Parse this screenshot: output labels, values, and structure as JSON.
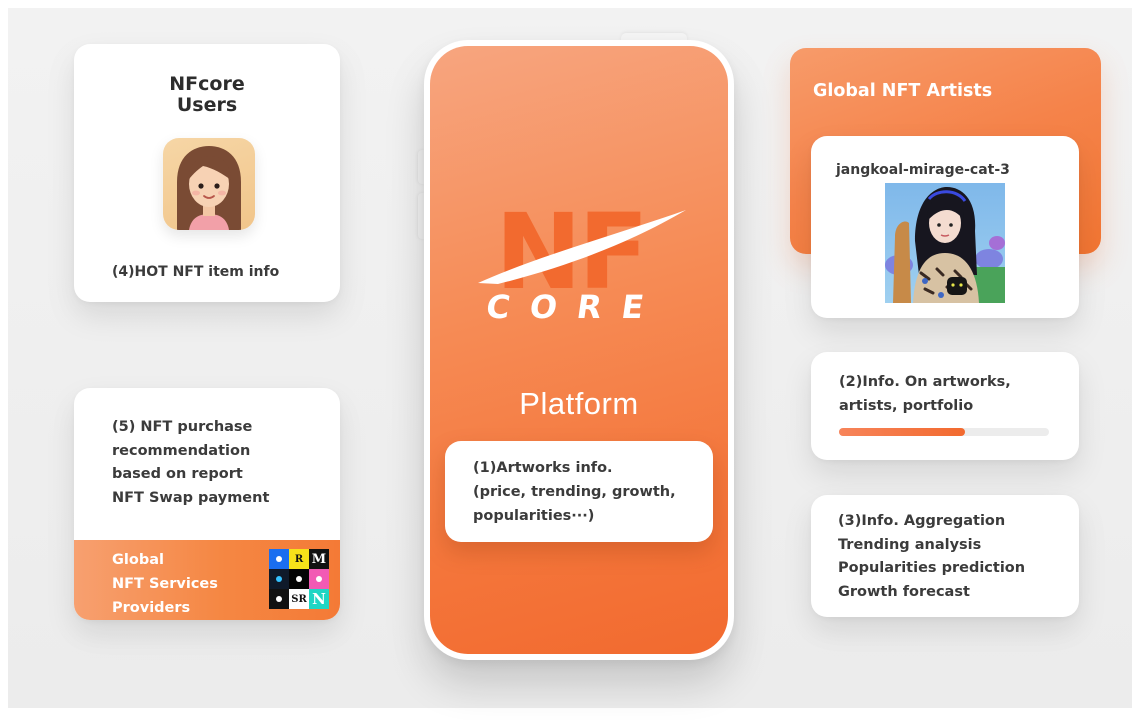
{
  "users_card": {
    "title_line1": "NFcore",
    "title_line2": "Users",
    "hot_label": "(4)HOT NFT item info"
  },
  "purchase_card": {
    "lines": [
      "(5) NFT purchase",
      "recommendation",
      "based on report",
      "NFT Swap payment"
    ],
    "providers_lines": [
      "Global",
      "NFT Services",
      "Providers"
    ],
    "provider_logos": [
      {
        "label": "",
        "bg": "#1a6ef0",
        "fg": "#ffffff"
      },
      {
        "label": "R",
        "bg": "#f7e11a",
        "fg": "#111111"
      },
      {
        "label": "M",
        "bg": "#111111",
        "fg": "#ffffff"
      },
      {
        "label": "",
        "bg": "#0f1a2a",
        "fg": "#35c2ff"
      },
      {
        "label": "",
        "bg": "#050505",
        "fg": "#ffffff"
      },
      {
        "label": "",
        "bg": "#f25ab4",
        "fg": "#ffffff"
      },
      {
        "label": "",
        "bg": "#111111",
        "fg": "#ffffff"
      },
      {
        "label": "SR",
        "bg": "#ffffff",
        "fg": "#111111"
      },
      {
        "label": "N",
        "bg": "#1fd6c4",
        "fg": "#ffffff"
      }
    ]
  },
  "phone": {
    "logo_top": "NF",
    "logo_bottom": "CORE",
    "platform_label": "Platform",
    "artworks_lines": [
      "(1)Artworks info.",
      "(price, trending, growth,",
      "popularities···)"
    ]
  },
  "artists": {
    "title": "Global NFT Artists",
    "artwork_name": "jangkoal-mirage-cat-3"
  },
  "info2": {
    "lines": [
      "(2)Info. On artworks,",
      "artists, portfolio"
    ],
    "progress": 0.6
  },
  "info3": {
    "lines": [
      "(3)Info. Aggregation",
      "Trending analysis",
      "Popularities prediction",
      "Growth forecast"
    ]
  },
  "colors": {
    "accent": "#f47a36",
    "accent_light": "#f7a57f",
    "text": "#3b3b3b"
  }
}
